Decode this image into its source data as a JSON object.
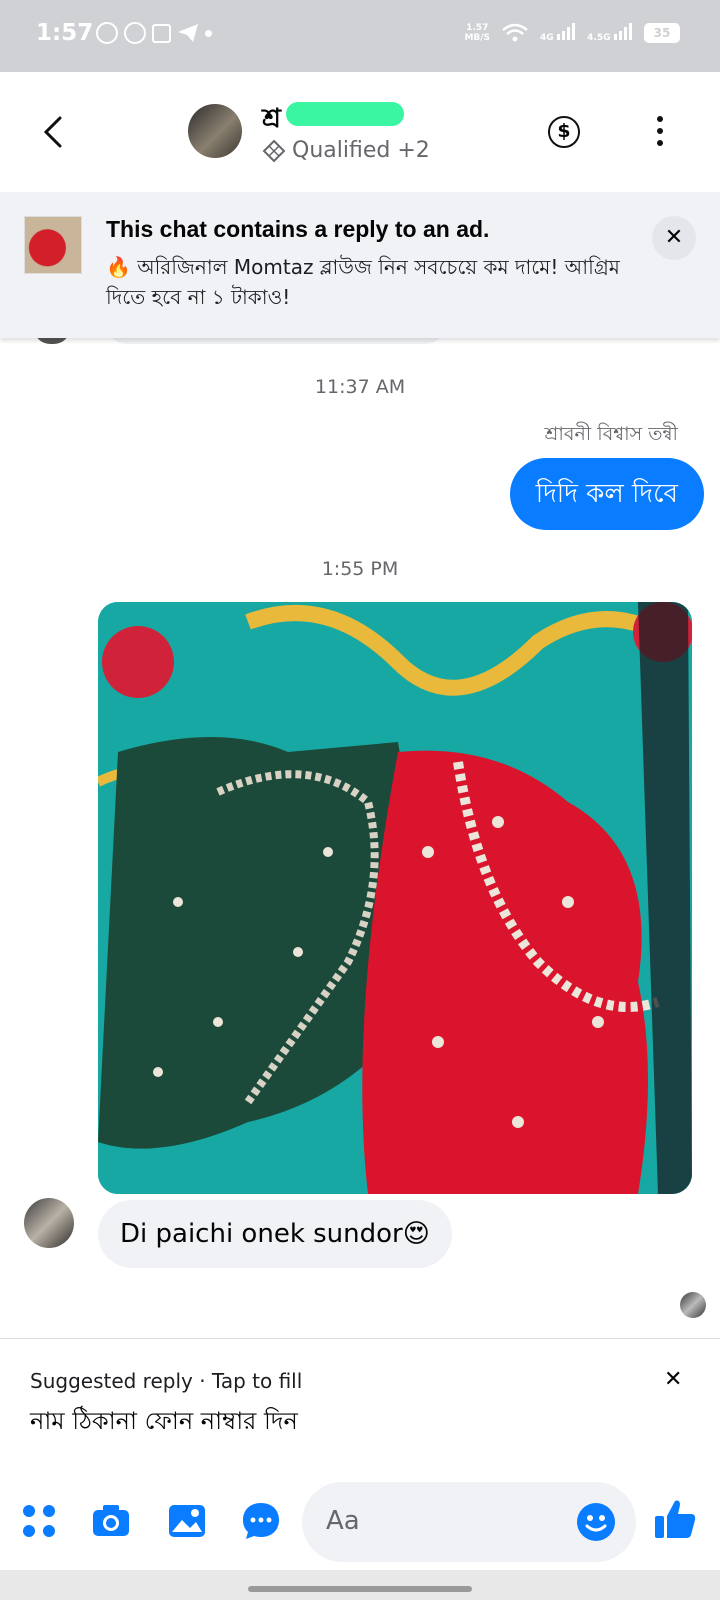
{
  "status_bar": {
    "time": "1:57",
    "net_speed_value": "1.57",
    "net_speed_unit": "MB/S",
    "sim1": "4G",
    "sim2": "4.5G",
    "battery": "35"
  },
  "header": {
    "contact_name_visible": "শ্র",
    "label": "Qualified +2"
  },
  "ad_banner": {
    "title": "This chat contains a reply to an ad.",
    "description": "🔥 অরিজিনাল Momtaz ব্লাউজ নিন সবচেয়ে কম দামে! আগ্রিম দিতে হবে না ১ টাকাও!"
  },
  "messages": {
    "ts1": "11:37 AM",
    "sender_name": "শ্রাবনী বিশ্বাস তন্বী",
    "outgoing_text": "দিদি কল দিবে",
    "ts2": "1:55 PM",
    "incoming_text": "Di paichi onek sundor😍"
  },
  "suggested_reply": {
    "label": "Suggested reply · Tap to fill",
    "text": "নাম ঠিকানা ফোন নাম্বার দিন",
    "close": "✕"
  },
  "composer": {
    "placeholder": "Aa"
  },
  "colors": {
    "accent": "#0a7cff",
    "bubble_in": "#f0f2f5",
    "muted_text": "#65676b"
  }
}
